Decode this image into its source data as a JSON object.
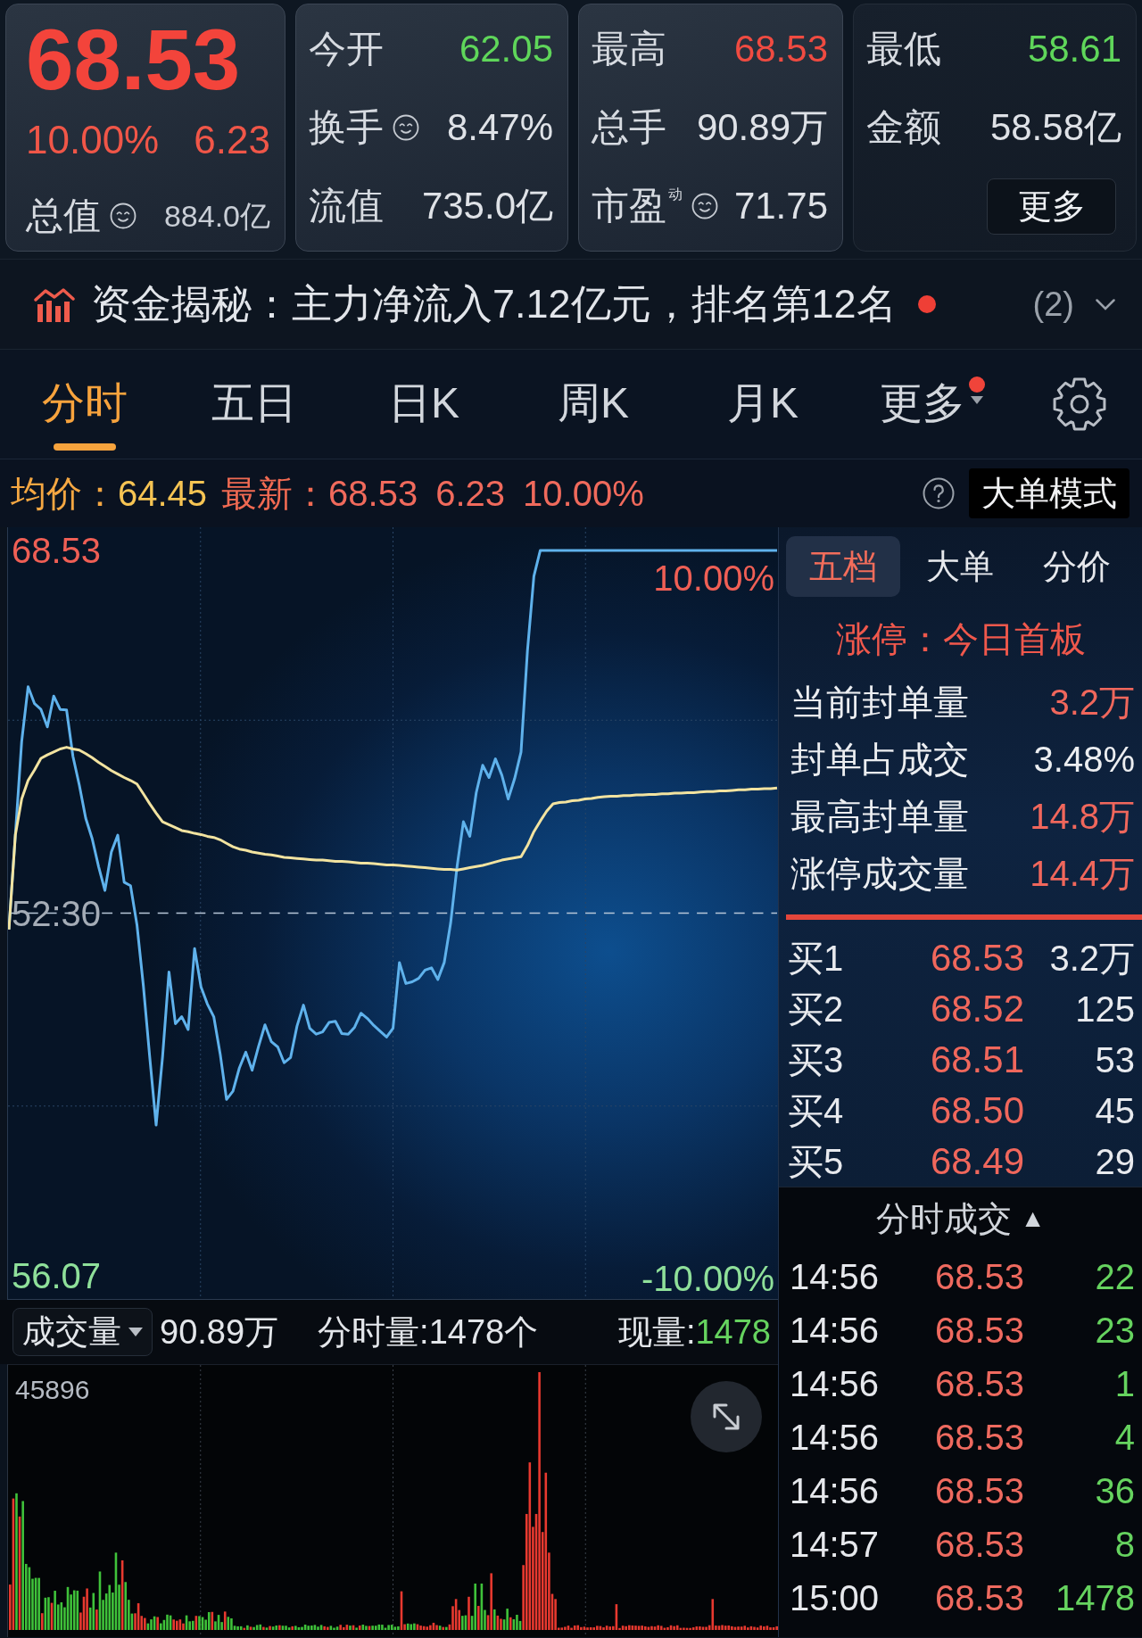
{
  "quote": {
    "price": "68.53",
    "change_pct": "10.00%",
    "change": "6.23",
    "cap_label": "总值",
    "cap_hint": true,
    "cap_value": "884.0亿"
  },
  "stat_cards": [
    {
      "rows": [
        {
          "label": "今开",
          "hint": false,
          "value": "62.05",
          "color": "#5fd65a"
        },
        {
          "label": "换手",
          "hint": true,
          "value": "8.47%",
          "color": "#dfe2e7"
        },
        {
          "label": "流值",
          "hint": false,
          "value": "735.0亿",
          "color": "#dfe2e7"
        }
      ]
    },
    {
      "rows": [
        {
          "label": "最高",
          "hint": false,
          "value": "68.53",
          "color": "#f04b41"
        },
        {
          "label": "总手",
          "hint": false,
          "value": "90.89万",
          "color": "#dfe2e7"
        },
        {
          "label": "市盈$^{动}$",
          "hint": true,
          "value": "71.75",
          "color": "#dfe2e7"
        }
      ]
    },
    {
      "rows": [
        {
          "label": "最低",
          "hint": false,
          "value": "58.61",
          "color": "#5fd65a"
        },
        {
          "label": "金额",
          "hint": false,
          "value": "58.58亿",
          "color": "#dfe2e7"
        }
      ],
      "more_button": "更多"
    }
  ],
  "fund_flow": {
    "title": "资金揭秘：主力净流入7.12亿元，排名第12名",
    "unread": true,
    "count": "(2)"
  },
  "tabs": [
    {
      "label": "分时",
      "selected": true,
      "badge": false,
      "dropdown": false
    },
    {
      "label": "五日",
      "selected": false,
      "badge": false,
      "dropdown": false
    },
    {
      "label": "日K",
      "selected": false,
      "badge": false,
      "dropdown": false
    },
    {
      "label": "周K",
      "selected": false,
      "badge": false,
      "dropdown": false
    },
    {
      "label": "月K",
      "selected": false,
      "badge": false,
      "dropdown": false
    },
    {
      "label": "更多",
      "selected": false,
      "badge": true,
      "dropdown": true
    }
  ],
  "info_line": {
    "avg_label": "均价：",
    "avg": "64.45",
    "last_label": "最新：",
    "last": "68.53",
    "change": "6.23",
    "change_pct": "10.00%",
    "mode_button": "大单模式"
  },
  "chart": {
    "chart_data": {
      "type": "line",
      "categories": [
        null,
        null,
        null,
        null,
        null,
        null,
        null,
        null,
        null,
        null,
        null,
        null,
        null,
        null,
        null,
        null,
        null,
        null,
        null,
        null,
        null,
        null,
        null,
        null,
        null,
        null,
        null,
        null,
        null,
        null,
        null,
        null,
        null,
        null,
        null,
        null,
        null,
        null,
        null,
        null,
        null,
        null,
        null,
        null,
        null,
        null,
        null,
        null,
        null,
        null,
        null,
        null,
        null,
        null,
        null,
        null,
        null,
        null,
        null,
        null,
        null,
        null,
        null,
        null,
        null,
        null,
        null,
        null,
        null,
        null,
        null,
        null,
        null,
        null,
        null,
        null,
        null,
        null,
        null,
        null,
        null,
        null,
        null,
        null,
        null,
        null,
        null,
        null,
        null,
        null,
        null,
        null,
        null,
        null,
        null,
        null,
        null,
        null,
        null,
        null,
        null,
        null,
        null,
        null,
        null,
        null,
        null,
        null,
        null,
        null,
        null,
        null,
        null,
        null,
        null,
        null,
        null,
        null,
        null,
        null,
        null
      ],
      "ylim": [
        55.67,
        68.93
      ],
      "yticks": [
        {
          "value": 68.53,
          "label": "68.53"
        },
        {
          "value": 56.07,
          "label": "56.07"
        }
      ],
      "series": [
        {
          "color": "#5fb2ec",
          "values": [
            62.02,
            63.64,
            65.25,
            66.19,
            65.9,
            65.8,
            65.5,
            66.03,
            65.8,
            65.79,
            64.99,
            64.5,
            63.93,
            63.58,
            63.1,
            62.69,
            63.35,
            63.64,
            62.83,
            62.77,
            62.1,
            61.05,
            59.83,
            58.66,
            59.83,
            61.29,
            60.4,
            60.52,
            60.3,
            61.69,
            61.03,
            60.74,
            60.52,
            59.88,
            59.1,
            59.24,
            59.64,
            59.91,
            59.6,
            60.01,
            60.38,
            60.09,
            60.0,
            59.73,
            59.82,
            60.36,
            60.72,
            60.32,
            60.22,
            60.26,
            60.42,
            60.44,
            60.23,
            60.22,
            60.34,
            60.58,
            60.49,
            60.37,
            60.27,
            60.17,
            60.32,
            61.45,
            61.09,
            61.12,
            61.18,
            61.32,
            61.36,
            61.16,
            61.45,
            62.13,
            63.1,
            63.87,
            63.62,
            64.37,
            64.84,
            64.63,
            64.95,
            64.67,
            64.26,
            64.61,
            65.07,
            66.81,
            68.09,
            68.53,
            68.53,
            68.53,
            68.53,
            68.53,
            68.53,
            68.53,
            68.53,
            68.53,
            68.53,
            68.53,
            68.53,
            68.53,
            68.53,
            68.53,
            68.53,
            68.53,
            68.53,
            68.53,
            68.53,
            68.53,
            68.53,
            68.53,
            68.53,
            68.53,
            68.53,
            68.53,
            68.53,
            68.53,
            68.53,
            68.53,
            68.53,
            68.53,
            68.53,
            68.53,
            68.53,
            68.53,
            68.53
          ]
        },
        {
          "color": "#f2e3a0",
          "values": [
            62.02,
            63.64,
            64.26,
            64.58,
            64.76,
            64.96,
            65.02,
            65.07,
            65.12,
            65.15,
            65.12,
            65.1,
            65.04,
            64.97,
            64.89,
            64.82,
            64.75,
            64.69,
            64.63,
            64.58,
            64.52,
            64.35,
            64.18,
            64.02,
            63.87,
            63.82,
            63.77,
            63.72,
            63.7,
            63.67,
            63.65,
            63.62,
            63.6,
            63.56,
            63.5,
            63.44,
            63.4,
            63.38,
            63.35,
            63.33,
            63.31,
            63.3,
            63.28,
            63.26,
            63.25,
            63.24,
            63.23,
            63.22,
            63.21,
            63.21,
            63.2,
            63.19,
            63.19,
            63.18,
            63.17,
            63.16,
            63.16,
            63.15,
            63.14,
            63.13,
            63.13,
            63.12,
            63.11,
            63.1,
            63.09,
            63.08,
            63.07,
            63.06,
            63.05,
            63.05,
            63.04,
            63.06,
            63.08,
            63.1,
            63.12,
            63.15,
            63.18,
            63.21,
            63.23,
            63.25,
            63.27,
            63.46,
            63.7,
            63.88,
            64.05,
            64.18,
            64.2,
            64.21,
            64.23,
            64.24,
            64.26,
            64.27,
            64.29,
            64.3,
            64.31,
            64.31,
            64.32,
            64.32,
            64.33,
            64.33,
            64.34,
            64.34,
            64.35,
            64.35,
            64.36,
            64.36,
            64.37,
            64.37,
            64.38,
            64.39,
            64.39,
            64.4,
            64.4,
            64.41,
            64.42,
            64.42,
            64.43,
            64.43,
            64.44,
            64.44,
            64.45
          ]
        },
        {
          "color": "#b7c6d8",
          "line_style": "dashed",
          "values": [
            62.3,
            62.3,
            62.3,
            62.3,
            62.3,
            62.3,
            62.3,
            62.3,
            62.3,
            62.3,
            62.3,
            62.3,
            62.3,
            62.3,
            62.3,
            62.3,
            62.3,
            62.3,
            62.3,
            62.3,
            62.3,
            62.3,
            62.3,
            62.3,
            62.3,
            62.3,
            62.3,
            62.3,
            62.3,
            62.3,
            62.3,
            62.3,
            62.3,
            62.3,
            62.3,
            62.3,
            62.3,
            62.3,
            62.3,
            62.3,
            62.3,
            62.3,
            62.3,
            62.3,
            62.3,
            62.3,
            62.3,
            62.3,
            62.3,
            62.3,
            62.3,
            62.3,
            62.3,
            62.3,
            62.3,
            62.3,
            62.3,
            62.3,
            62.3,
            62.3,
            62.3,
            62.3,
            62.3,
            62.3,
            62.3,
            62.3,
            62.3,
            62.3,
            62.3,
            62.3,
            62.3,
            62.3,
            62.3,
            62.3,
            62.3,
            62.3,
            62.3,
            62.3,
            62.3,
            62.3,
            62.3,
            62.3,
            62.3,
            62.3,
            62.3,
            62.3,
            62.3,
            62.3,
            62.3,
            62.3,
            62.3,
            62.3,
            62.3,
            62.3,
            62.3,
            62.3,
            62.3,
            62.3,
            62.3,
            62.3,
            62.3,
            62.3,
            62.3,
            62.3,
            62.3,
            62.3,
            62.3,
            62.3,
            62.3,
            62.3,
            62.3,
            62.3,
            62.3,
            62.3,
            62.3,
            62.3,
            62.3,
            62.3,
            62.3,
            62.3,
            62.3
          ]
        }
      ]
    },
    "midline_label": "52:30",
    "pct_labels": [
      "10.00%",
      "-10.00%"
    ]
  },
  "volume": {
    "selector": "成交量",
    "total": "90.89万",
    "minute_volume": "分时量:1478个",
    "current_label": "现量:",
    "current": "1478",
    "scale_label": "45896"
  },
  "order_panel": {
    "tabs": [
      {
        "label": "五档",
        "selected": true
      },
      {
        "label": "大单",
        "selected": false
      },
      {
        "label": "分价",
        "selected": false
      }
    ],
    "limit_status": "涨停：今日首板",
    "stats": [
      {
        "label": "当前封单量",
        "value": "3.2万",
        "color": "#f0675c"
      },
      {
        "label": "封单占成交",
        "value": "3.48%",
        "color": "#eceef1"
      },
      {
        "label": "最高封单量",
        "value": "14.8万",
        "color": "#f0675c"
      },
      {
        "label": "涨停成交量",
        "value": "14.4万",
        "color": "#f0675c"
      }
    ],
    "bids": [
      {
        "label": "买1",
        "price": "68.53",
        "volume": "3.2万"
      },
      {
        "label": "买2",
        "price": "68.52",
        "volume": "125"
      },
      {
        "label": "买3",
        "price": "68.51",
        "volume": "53"
      },
      {
        "label": "买4",
        "price": "68.50",
        "volume": "45"
      },
      {
        "label": "买5",
        "price": "68.49",
        "volume": "29"
      }
    ]
  },
  "trades": {
    "title": "分时成交",
    "sort_mark": "▲",
    "rows": [
      {
        "time": "14:56",
        "price": "68.53",
        "volume": "22"
      },
      {
        "time": "14:56",
        "price": "68.53",
        "volume": "23"
      },
      {
        "time": "14:56",
        "price": "68.53",
        "volume": "1"
      },
      {
        "time": "14:56",
        "price": "68.53",
        "volume": "4"
      },
      {
        "time": "14:56",
        "price": "68.53",
        "volume": "36"
      },
      {
        "time": "14:57",
        "price": "68.53",
        "volume": "8"
      },
      {
        "time": "15:00",
        "price": "68.53",
        "volume": "1478"
      }
    ]
  }
}
